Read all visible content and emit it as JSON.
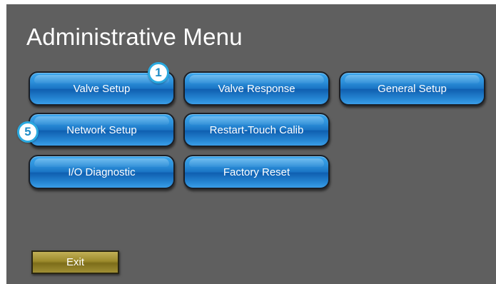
{
  "screen": {
    "title": "Administrative Menu"
  },
  "buttons": {
    "valve_setup": "Valve Setup",
    "valve_response": "Valve Response",
    "general_setup": "General Setup",
    "network_setup": "Network Setup",
    "restart_touch_calib": "Restart-Touch Calib",
    "io_diagnostic": "I/O Diagnostic",
    "factory_reset": "Factory Reset",
    "exit": "Exit"
  },
  "callouts": {
    "first": "1",
    "second": "5"
  },
  "colors": {
    "background": "#5f5f5f",
    "button_blue": "#1a74c4",
    "exit_gold": "#9c8a2c",
    "callout_ring": "#2aa9e0"
  }
}
